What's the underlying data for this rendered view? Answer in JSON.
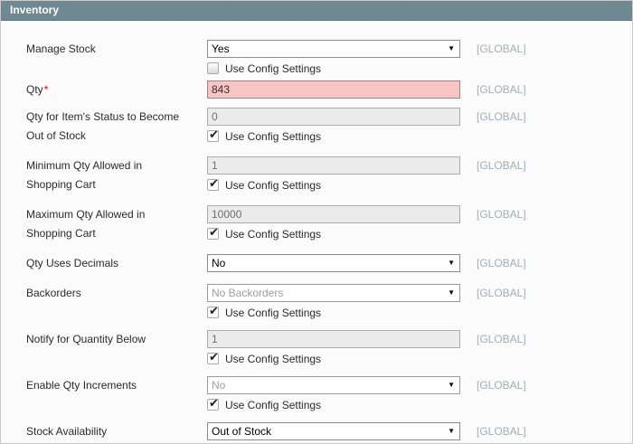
{
  "panel": {
    "title": "Inventory"
  },
  "shared": {
    "use_config_label": "Use Config Settings",
    "scope_label": "[GLOBAL]"
  },
  "colors": {
    "header_bg": "#6f8992",
    "header_text": "#ffffff",
    "error_field_bg": "#f8c5c5",
    "required_mark": "#d40701",
    "scope_text": "#a4aeb3",
    "disabled_field_bg": "#ebebeb"
  },
  "rows": [
    {
      "label": "Manage Stock",
      "required_mark": "",
      "control": "select",
      "value": "Yes",
      "disabled": false,
      "error": false,
      "use_config": true,
      "checked": false
    },
    {
      "label": "Qty",
      "required_mark": "*",
      "control": "input",
      "value": "843",
      "disabled": false,
      "error": true,
      "use_config": false,
      "checked": false
    },
    {
      "label": "Qty for Item's Status to Become Out of Stock",
      "required_mark": "",
      "control": "input",
      "value": "0",
      "disabled": true,
      "error": false,
      "use_config": true,
      "checked": true
    },
    {
      "label": "Minimum Qty Allowed in Shopping Cart",
      "required_mark": "",
      "control": "input",
      "value": "1",
      "disabled": true,
      "error": false,
      "use_config": true,
      "checked": true
    },
    {
      "label": "Maximum Qty Allowed in Shopping Cart",
      "required_mark": "",
      "control": "input",
      "value": "10000",
      "disabled": true,
      "error": false,
      "use_config": true,
      "checked": true
    },
    {
      "label": "Qty Uses Decimals",
      "required_mark": "",
      "control": "select",
      "value": "No",
      "disabled": false,
      "error": false,
      "use_config": false,
      "checked": false
    },
    {
      "label": "Backorders",
      "required_mark": "",
      "control": "select",
      "value": "No Backorders",
      "disabled": true,
      "error": false,
      "use_config": true,
      "checked": true
    },
    {
      "label": "Notify for Quantity Below",
      "required_mark": "",
      "control": "input",
      "value": "1",
      "disabled": true,
      "error": false,
      "use_config": true,
      "checked": true
    },
    {
      "label": "Enable Qty Increments",
      "required_mark": "",
      "control": "select",
      "value": "No",
      "disabled": true,
      "error": false,
      "use_config": true,
      "checked": true
    },
    {
      "label": "Stock Availability",
      "required_mark": "",
      "control": "select",
      "value": "Out of Stock",
      "disabled": false,
      "error": false,
      "use_config": false,
      "checked": false
    }
  ]
}
